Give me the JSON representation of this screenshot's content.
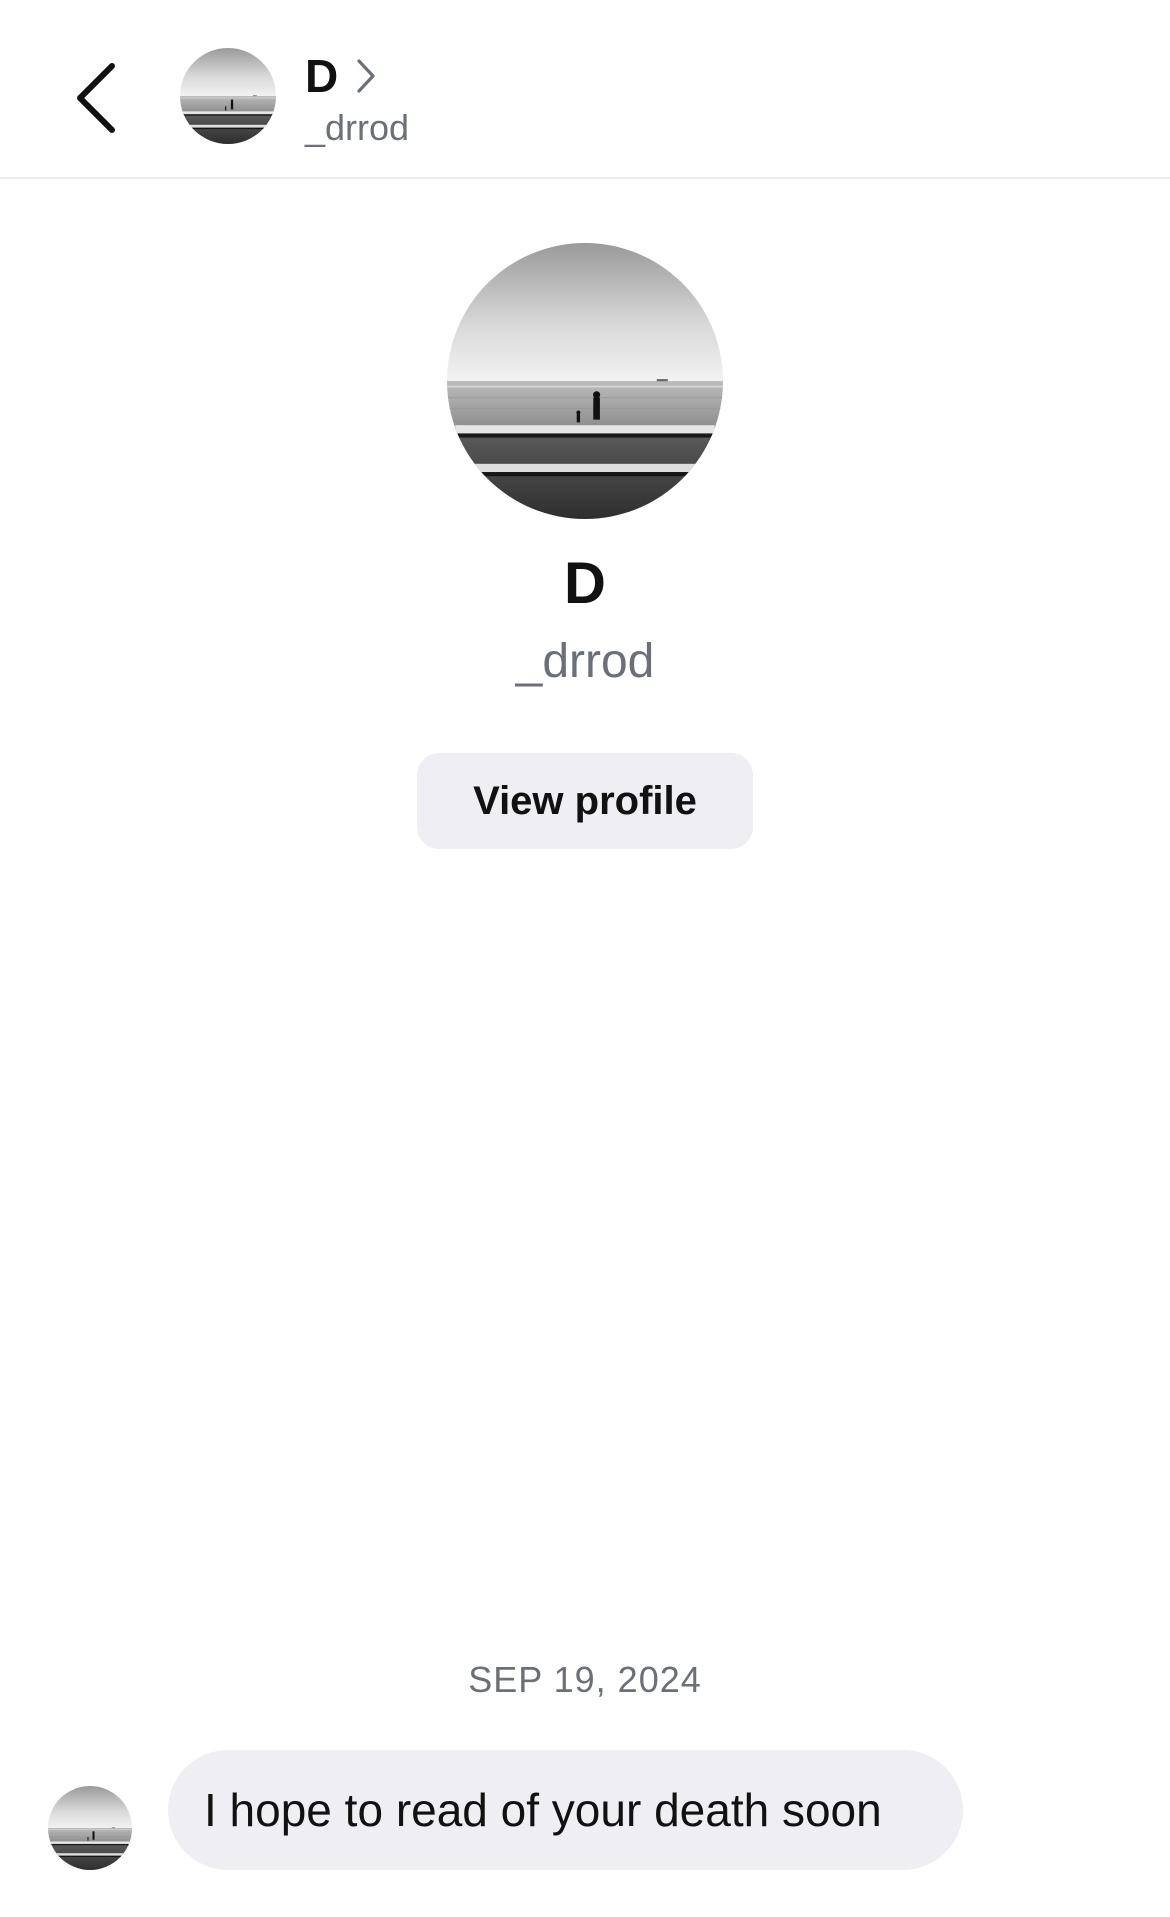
{
  "header": {
    "back_icon": "chevron-left-icon",
    "name": "D",
    "chevron_icon": "chevron-right-icon",
    "handle": "_drrod"
  },
  "profile": {
    "name": "D",
    "handle": "_drrod",
    "view_profile_label": "View profile"
  },
  "conversation": {
    "date_divider": "SEP 19, 2024",
    "messages": [
      {
        "sender": "incoming",
        "text": "I hope to read of your death soon"
      }
    ]
  },
  "colors": {
    "background": "#ffffff",
    "bubble": "#efeff3",
    "secondary_text": "#6b6f76",
    "primary_text": "#111111",
    "divider": "#ececec"
  }
}
